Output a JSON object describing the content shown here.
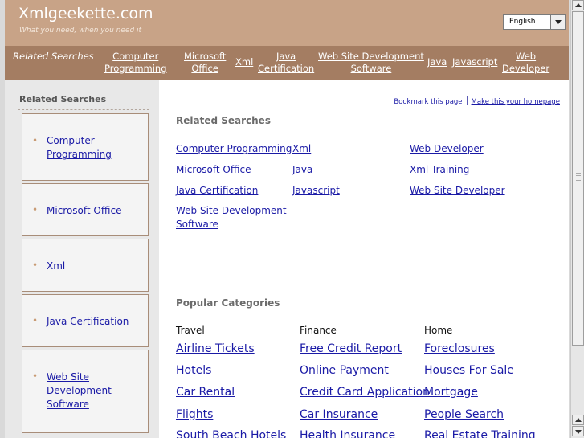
{
  "header": {
    "title": "Xmlgeekette.com",
    "tagline": "What you need, when you need it",
    "language": "English"
  },
  "nav": {
    "label": "Related Searches",
    "links": [
      {
        "line1": "Computer",
        "line2": "Programming"
      },
      {
        "line1": "Microsoft",
        "line2": "Office"
      },
      {
        "line1": "Xml",
        "line2": ""
      },
      {
        "line1": "Java",
        "line2": "Certification"
      },
      {
        "line1": "Web Site Development",
        "line2": "Software"
      },
      {
        "line1": "Java",
        "line2": ""
      },
      {
        "line1": "Javascript",
        "line2": ""
      },
      {
        "line1": "Web",
        "line2": "Developer"
      }
    ]
  },
  "sidebar": {
    "title": "Related Searches",
    "items": [
      {
        "line1": "Computer",
        "line2": "Programming",
        "line3": ""
      },
      {
        "line1": "Microsoft Office",
        "line2": "",
        "line3": ""
      },
      {
        "line1": "Xml",
        "line2": "",
        "line3": ""
      },
      {
        "line1": "Java Certification",
        "line2": "",
        "line3": ""
      },
      {
        "line1": "Web Site",
        "line2": "Development",
        "line3": "Software"
      }
    ]
  },
  "top_links": {
    "bookmark": "Bookmark this page",
    "homepage": "Make this your homepage"
  },
  "related": {
    "title": "Related Searches",
    "links": [
      {
        "line1": "Computer Programming",
        "line2": ""
      },
      {
        "line1": "Xml",
        "line2": ""
      },
      {
        "line1": "Web Developer",
        "line2": ""
      },
      {
        "line1": "Microsoft Office",
        "line2": ""
      },
      {
        "line1": "Java",
        "line2": ""
      },
      {
        "line1": "Xml Training",
        "line2": ""
      },
      {
        "line1": "Java Certification",
        "line2": ""
      },
      {
        "line1": "Javascript",
        "line2": ""
      },
      {
        "line1": "Web Site Developer",
        "line2": ""
      },
      {
        "line1": "Web Site Development",
        "line2": "Software"
      }
    ]
  },
  "popular": {
    "title": "Popular Categories",
    "columns": [
      {
        "heading": "Travel",
        "links": [
          "Airline Tickets",
          "Hotels",
          "Car Rental",
          "Flights",
          "South Beach Hotels"
        ]
      },
      {
        "heading": "Finance",
        "links": [
          "Free Credit Report",
          "Online Payment",
          "Credit Card Application",
          "Car Insurance",
          "Health Insurance"
        ]
      },
      {
        "heading": "Home",
        "links": [
          "Foreclosures",
          "Houses For Sale",
          "Mortgage",
          "People Search",
          "Real Estate Training"
        ]
      }
    ]
  }
}
